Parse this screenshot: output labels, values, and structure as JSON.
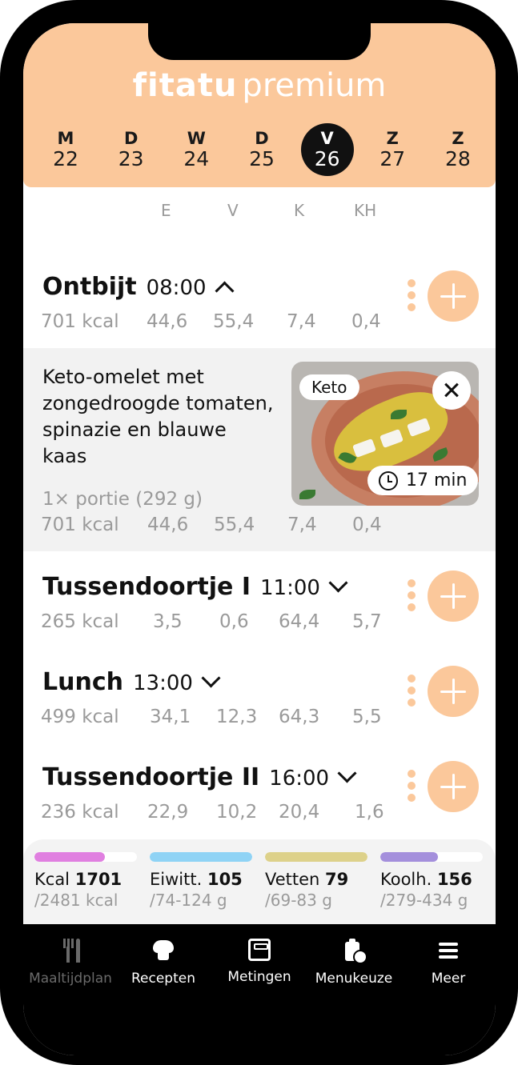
{
  "brand": {
    "bold": "fitatu",
    "light": "premium"
  },
  "days": [
    {
      "letter": "M",
      "num": "22",
      "active": false
    },
    {
      "letter": "D",
      "num": "23",
      "active": false
    },
    {
      "letter": "W",
      "num": "24",
      "active": false
    },
    {
      "letter": "D",
      "num": "25",
      "active": false
    },
    {
      "letter": "V",
      "num": "26",
      "active": true
    },
    {
      "letter": "Z",
      "num": "27",
      "active": false
    },
    {
      "letter": "Z",
      "num": "28",
      "active": false
    }
  ],
  "macro_headers": [
    "E",
    "V",
    "K",
    "KH"
  ],
  "meals": [
    {
      "name": "Ontbijt",
      "time": "08:00",
      "expanded": true,
      "kcal": "701 kcal",
      "e": "44,6",
      "v": "55,4",
      "k": "7,4",
      "kh": "0,4"
    },
    {
      "name": "Tussendoortje I",
      "time": "11:00",
      "expanded": false,
      "kcal": "265 kcal",
      "e": "3,5",
      "v": "0,6",
      "k": "64,4",
      "kh": "5,7"
    },
    {
      "name": "Lunch",
      "time": "13:00",
      "expanded": false,
      "kcal": "499 kcal",
      "e": "34,1",
      "v": "12,3",
      "k": "64,3",
      "kh": "5,5"
    },
    {
      "name": "Tussendoortje II",
      "time": "16:00",
      "expanded": false,
      "kcal": "236 kcal",
      "e": "22,9",
      "v": "10,2",
      "k": "20,4",
      "kh": "1,6"
    }
  ],
  "item": {
    "name": "Keto-omelet met zongedroogde tomaten, spinazie en blauwe kaas",
    "portion": "1× portie (292 g)",
    "kcal": "701 kcal",
    "e": "44,6",
    "v": "55,4",
    "k": "7,4",
    "kh": "0,4",
    "tag": "Keto",
    "duration": "17 min",
    "icons": {
      "close": "close-icon",
      "clock": "clock-icon"
    }
  },
  "summary": [
    {
      "label": "Kcal",
      "value": "1701",
      "range": "/2481 kcal",
      "progress": 0.69,
      "color": "#e07fe0"
    },
    {
      "label": "Eiwitt.",
      "value": "105",
      "range": "/74-124 g",
      "progress": 1.0,
      "color": "#8fd3f5"
    },
    {
      "label": "Vetten",
      "value": "79",
      "range": "/69-83 g",
      "progress": 1.0,
      "color": "#ddd18a"
    },
    {
      "label": "Koolh.",
      "value": "156",
      "range": "/279-434 g",
      "progress": 0.56,
      "color": "#a48fdc"
    }
  ],
  "nav": [
    {
      "label": "Maaltijdplan",
      "icon": "fork-knife-icon",
      "active": false
    },
    {
      "label": "Recepten",
      "icon": "chef-hat-icon",
      "active": true
    },
    {
      "label": "Metingen",
      "icon": "scale-icon",
      "active": true
    },
    {
      "label": "Menukeuze",
      "icon": "clipboard-icon",
      "active": true
    },
    {
      "label": "Meer",
      "icon": "menu-icon",
      "active": true
    }
  ],
  "colors": {
    "accent": "#fbc89b",
    "dark": "#111111",
    "muted": "#9a9a9a"
  }
}
